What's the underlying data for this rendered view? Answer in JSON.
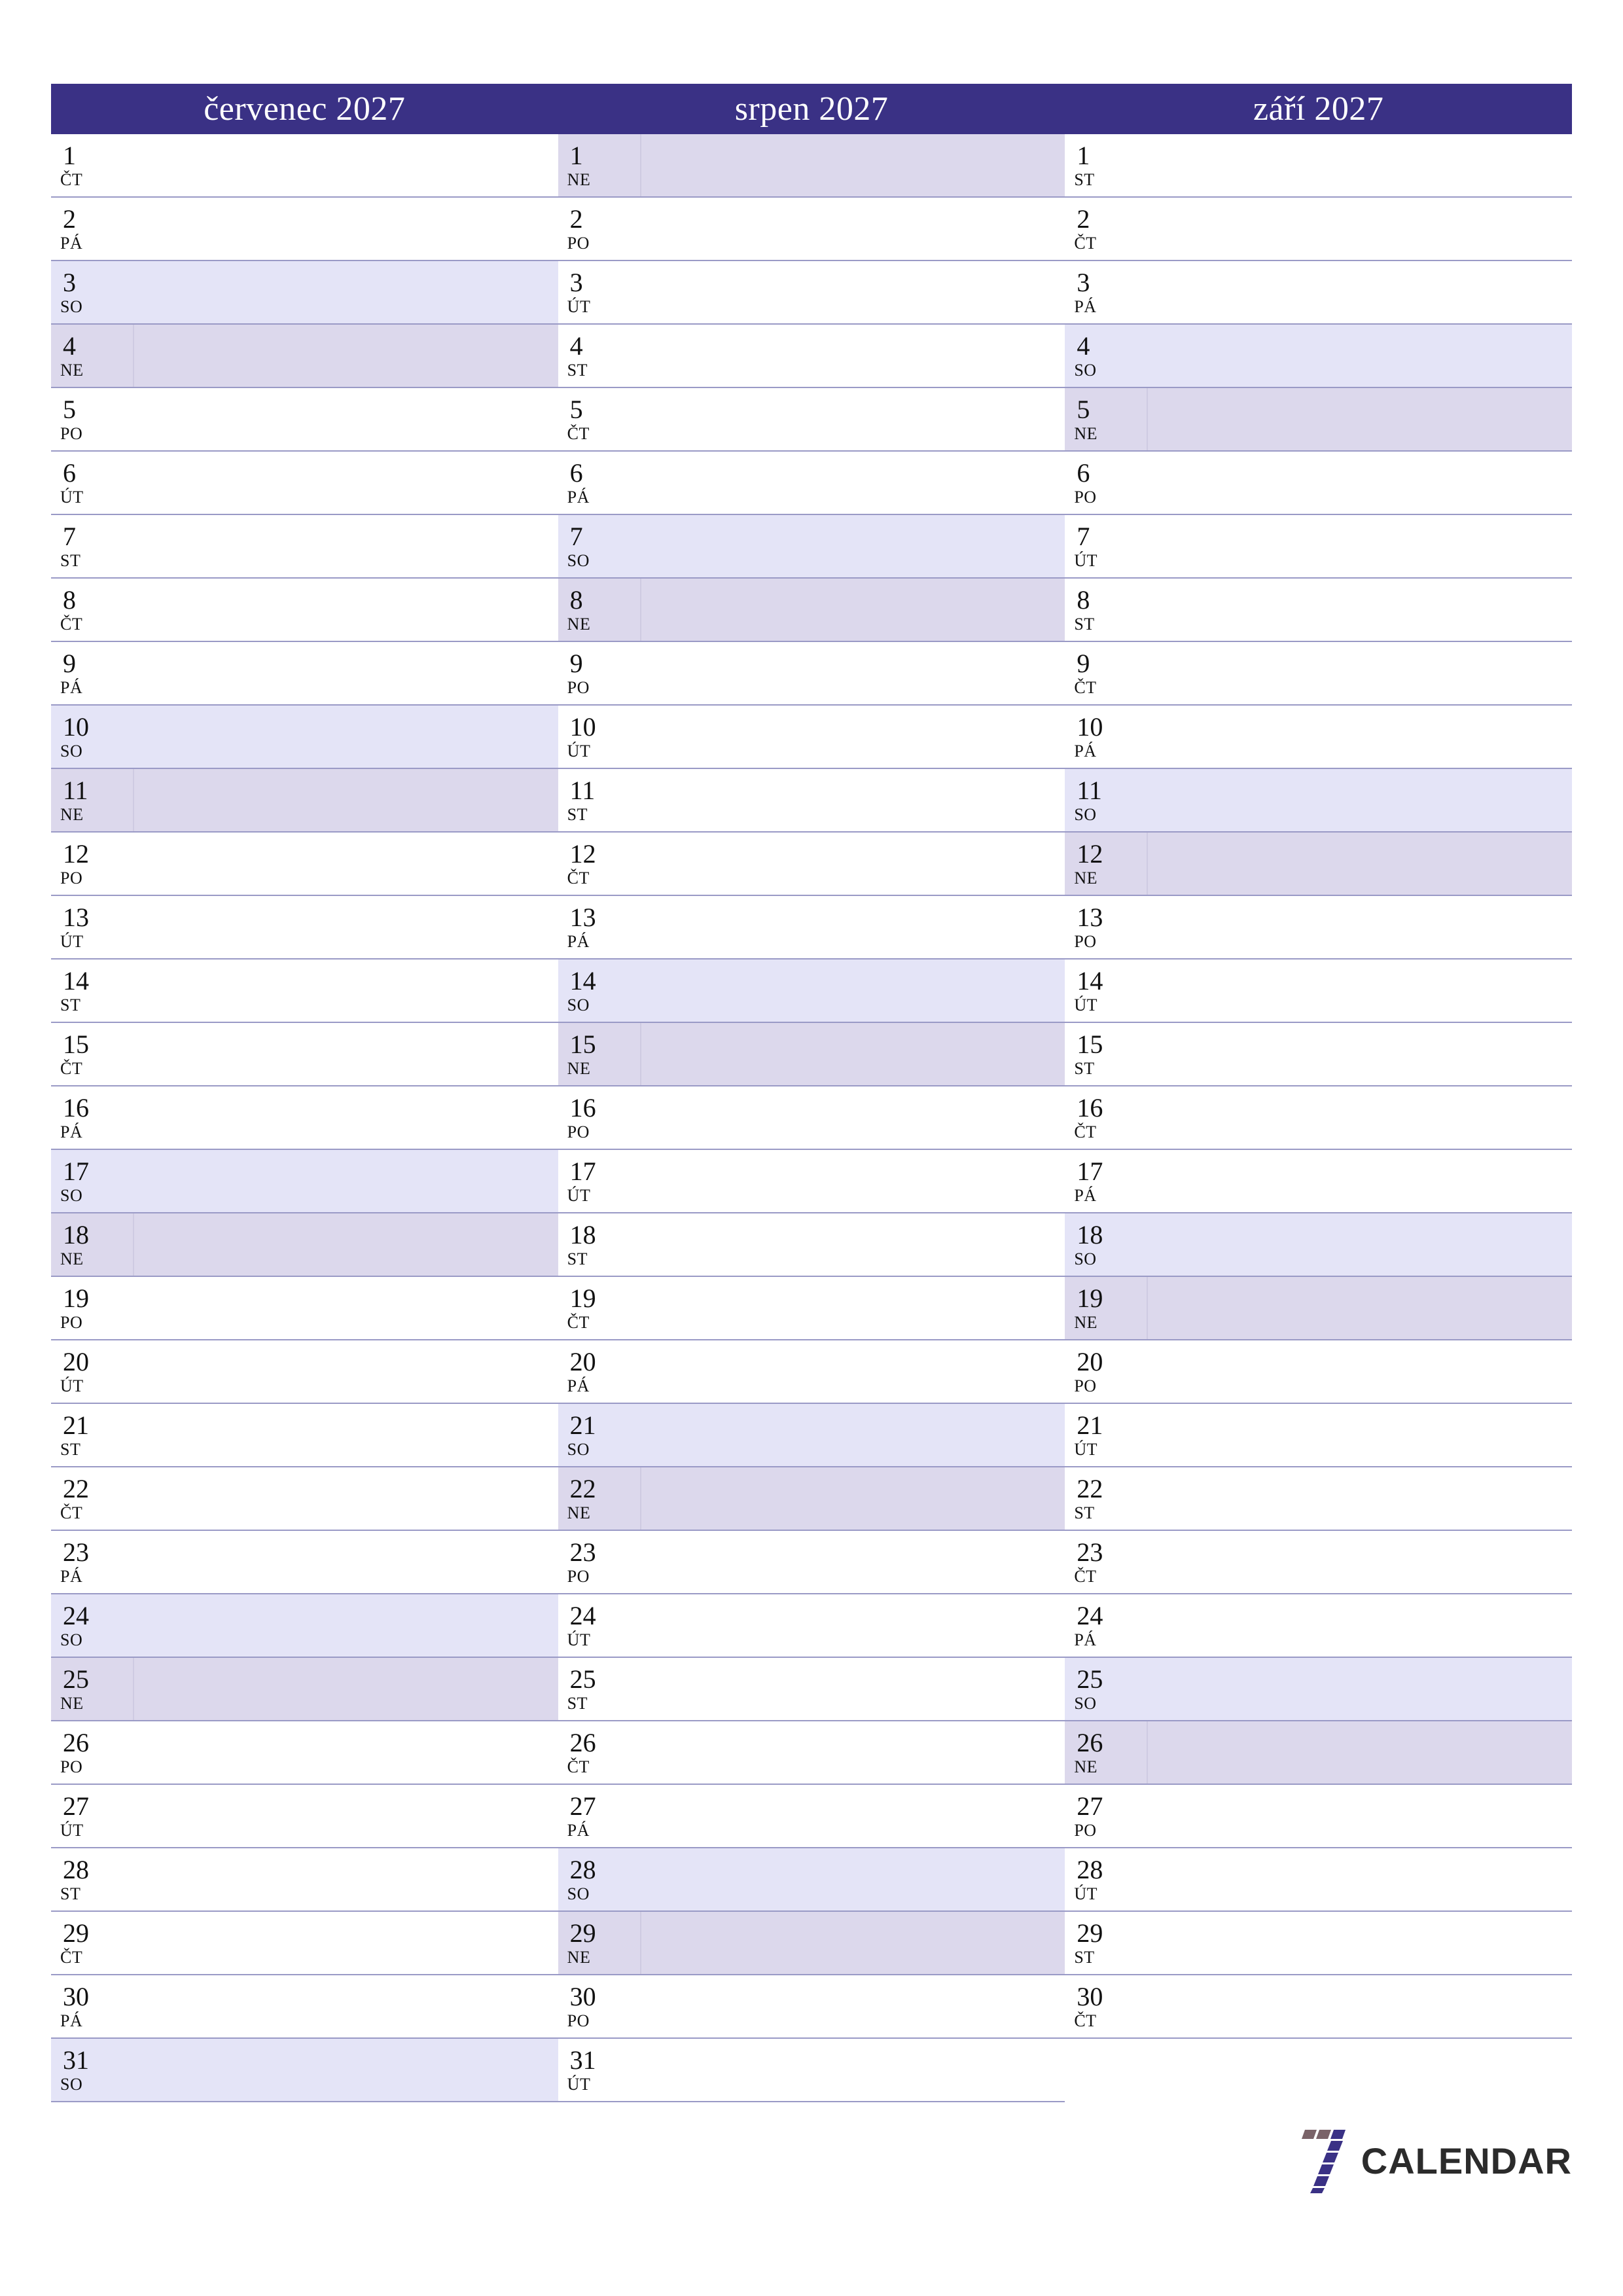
{
  "document": {
    "type": "three-month-planner",
    "year": "2027",
    "locale": "cs"
  },
  "colors": {
    "header_background": "#3a3185",
    "header_text": "#ffffff",
    "saturday_background": "#e4e4f7",
    "sunday_background": "#dcd8ec",
    "row_divider": "#9a9ac6",
    "day_text": "#111111",
    "logo_dark": "#3a3185",
    "logo_brown": "#7a6368",
    "logo_text": "#2b2b2b"
  },
  "months": [
    {
      "title": "červenec 2027",
      "name": "červenec",
      "year": "2027",
      "days": [
        {
          "num": "1",
          "dow": "ČT",
          "type": "weekday"
        },
        {
          "num": "2",
          "dow": "PÁ",
          "type": "weekday"
        },
        {
          "num": "3",
          "dow": "SO",
          "type": "saturday"
        },
        {
          "num": "4",
          "dow": "NE",
          "type": "sunday"
        },
        {
          "num": "5",
          "dow": "PO",
          "type": "weekday"
        },
        {
          "num": "6",
          "dow": "ÚT",
          "type": "weekday"
        },
        {
          "num": "7",
          "dow": "ST",
          "type": "weekday"
        },
        {
          "num": "8",
          "dow": "ČT",
          "type": "weekday"
        },
        {
          "num": "9",
          "dow": "PÁ",
          "type": "weekday"
        },
        {
          "num": "10",
          "dow": "SO",
          "type": "saturday"
        },
        {
          "num": "11",
          "dow": "NE",
          "type": "sunday"
        },
        {
          "num": "12",
          "dow": "PO",
          "type": "weekday"
        },
        {
          "num": "13",
          "dow": "ÚT",
          "type": "weekday"
        },
        {
          "num": "14",
          "dow": "ST",
          "type": "weekday"
        },
        {
          "num": "15",
          "dow": "ČT",
          "type": "weekday"
        },
        {
          "num": "16",
          "dow": "PÁ",
          "type": "weekday"
        },
        {
          "num": "17",
          "dow": "SO",
          "type": "saturday"
        },
        {
          "num": "18",
          "dow": "NE",
          "type": "sunday"
        },
        {
          "num": "19",
          "dow": "PO",
          "type": "weekday"
        },
        {
          "num": "20",
          "dow": "ÚT",
          "type": "weekday"
        },
        {
          "num": "21",
          "dow": "ST",
          "type": "weekday"
        },
        {
          "num": "22",
          "dow": "ČT",
          "type": "weekday"
        },
        {
          "num": "23",
          "dow": "PÁ",
          "type": "weekday"
        },
        {
          "num": "24",
          "dow": "SO",
          "type": "saturday"
        },
        {
          "num": "25",
          "dow": "NE",
          "type": "sunday"
        },
        {
          "num": "26",
          "dow": "PO",
          "type": "weekday"
        },
        {
          "num": "27",
          "dow": "ÚT",
          "type": "weekday"
        },
        {
          "num": "28",
          "dow": "ST",
          "type": "weekday"
        },
        {
          "num": "29",
          "dow": "ČT",
          "type": "weekday"
        },
        {
          "num": "30",
          "dow": "PÁ",
          "type": "weekday"
        },
        {
          "num": "31",
          "dow": "SO",
          "type": "saturday"
        }
      ]
    },
    {
      "title": "srpen 2027",
      "name": "srpen",
      "year": "2027",
      "days": [
        {
          "num": "1",
          "dow": "NE",
          "type": "sunday"
        },
        {
          "num": "2",
          "dow": "PO",
          "type": "weekday"
        },
        {
          "num": "3",
          "dow": "ÚT",
          "type": "weekday"
        },
        {
          "num": "4",
          "dow": "ST",
          "type": "weekday"
        },
        {
          "num": "5",
          "dow": "ČT",
          "type": "weekday"
        },
        {
          "num": "6",
          "dow": "PÁ",
          "type": "weekday"
        },
        {
          "num": "7",
          "dow": "SO",
          "type": "saturday"
        },
        {
          "num": "8",
          "dow": "NE",
          "type": "sunday"
        },
        {
          "num": "9",
          "dow": "PO",
          "type": "weekday"
        },
        {
          "num": "10",
          "dow": "ÚT",
          "type": "weekday"
        },
        {
          "num": "11",
          "dow": "ST",
          "type": "weekday"
        },
        {
          "num": "12",
          "dow": "ČT",
          "type": "weekday"
        },
        {
          "num": "13",
          "dow": "PÁ",
          "type": "weekday"
        },
        {
          "num": "14",
          "dow": "SO",
          "type": "saturday"
        },
        {
          "num": "15",
          "dow": "NE",
          "type": "sunday"
        },
        {
          "num": "16",
          "dow": "PO",
          "type": "weekday"
        },
        {
          "num": "17",
          "dow": "ÚT",
          "type": "weekday"
        },
        {
          "num": "18",
          "dow": "ST",
          "type": "weekday"
        },
        {
          "num": "19",
          "dow": "ČT",
          "type": "weekday"
        },
        {
          "num": "20",
          "dow": "PÁ",
          "type": "weekday"
        },
        {
          "num": "21",
          "dow": "SO",
          "type": "saturday"
        },
        {
          "num": "22",
          "dow": "NE",
          "type": "sunday"
        },
        {
          "num": "23",
          "dow": "PO",
          "type": "weekday"
        },
        {
          "num": "24",
          "dow": "ÚT",
          "type": "weekday"
        },
        {
          "num": "25",
          "dow": "ST",
          "type": "weekday"
        },
        {
          "num": "26",
          "dow": "ČT",
          "type": "weekday"
        },
        {
          "num": "27",
          "dow": "PÁ",
          "type": "weekday"
        },
        {
          "num": "28",
          "dow": "SO",
          "type": "saturday"
        },
        {
          "num": "29",
          "dow": "NE",
          "type": "sunday"
        },
        {
          "num": "30",
          "dow": "PO",
          "type": "weekday"
        },
        {
          "num": "31",
          "dow": "ÚT",
          "type": "weekday"
        }
      ]
    },
    {
      "title": "září 2027",
      "name": "září",
      "year": "2027",
      "days": [
        {
          "num": "1",
          "dow": "ST",
          "type": "weekday"
        },
        {
          "num": "2",
          "dow": "ČT",
          "type": "weekday"
        },
        {
          "num": "3",
          "dow": "PÁ",
          "type": "weekday"
        },
        {
          "num": "4",
          "dow": "SO",
          "type": "saturday"
        },
        {
          "num": "5",
          "dow": "NE",
          "type": "sunday"
        },
        {
          "num": "6",
          "dow": "PO",
          "type": "weekday"
        },
        {
          "num": "7",
          "dow": "ÚT",
          "type": "weekday"
        },
        {
          "num": "8",
          "dow": "ST",
          "type": "weekday"
        },
        {
          "num": "9",
          "dow": "ČT",
          "type": "weekday"
        },
        {
          "num": "10",
          "dow": "PÁ",
          "type": "weekday"
        },
        {
          "num": "11",
          "dow": "SO",
          "type": "saturday"
        },
        {
          "num": "12",
          "dow": "NE",
          "type": "sunday"
        },
        {
          "num": "13",
          "dow": "PO",
          "type": "weekday"
        },
        {
          "num": "14",
          "dow": "ÚT",
          "type": "weekday"
        },
        {
          "num": "15",
          "dow": "ST",
          "type": "weekday"
        },
        {
          "num": "16",
          "dow": "ČT",
          "type": "weekday"
        },
        {
          "num": "17",
          "dow": "PÁ",
          "type": "weekday"
        },
        {
          "num": "18",
          "dow": "SO",
          "type": "saturday"
        },
        {
          "num": "19",
          "dow": "NE",
          "type": "sunday"
        },
        {
          "num": "20",
          "dow": "PO",
          "type": "weekday"
        },
        {
          "num": "21",
          "dow": "ÚT",
          "type": "weekday"
        },
        {
          "num": "22",
          "dow": "ST",
          "type": "weekday"
        },
        {
          "num": "23",
          "dow": "ČT",
          "type": "weekday"
        },
        {
          "num": "24",
          "dow": "PÁ",
          "type": "weekday"
        },
        {
          "num": "25",
          "dow": "SO",
          "type": "saturday"
        },
        {
          "num": "26",
          "dow": "NE",
          "type": "sunday"
        },
        {
          "num": "27",
          "dow": "PO",
          "type": "weekday"
        },
        {
          "num": "28",
          "dow": "ÚT",
          "type": "weekday"
        },
        {
          "num": "29",
          "dow": "ST",
          "type": "weekday"
        },
        {
          "num": "30",
          "dow": "ČT",
          "type": "weekday"
        }
      ]
    }
  ],
  "logo": {
    "mark": "seven-logo-icon",
    "text": "CALENDAR"
  }
}
